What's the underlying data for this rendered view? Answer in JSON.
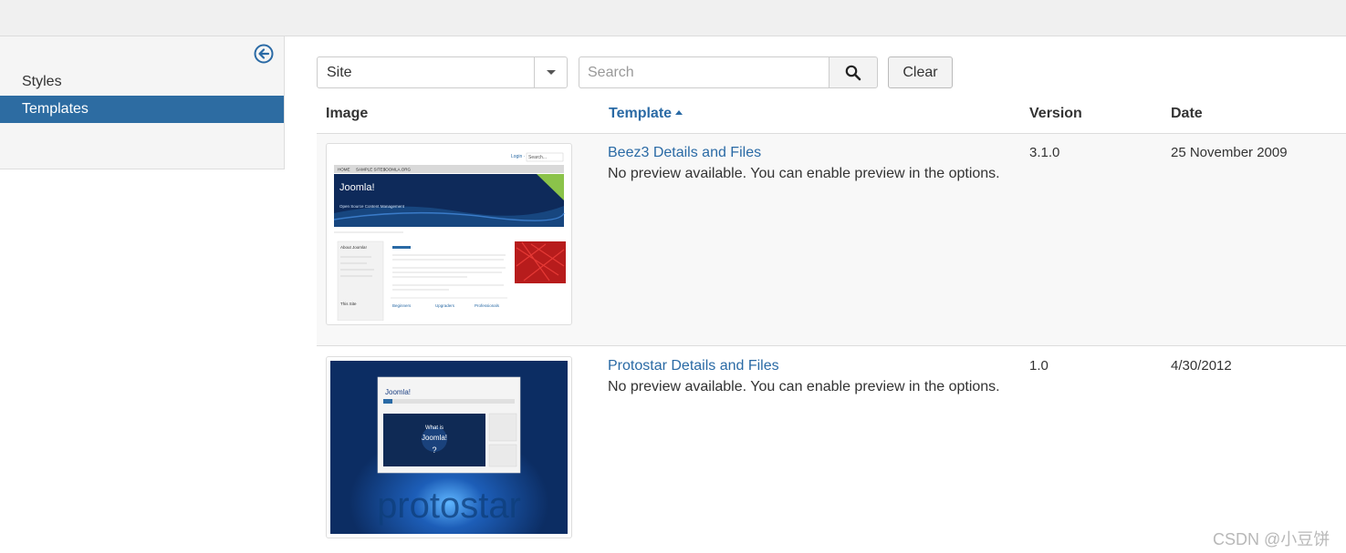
{
  "sidebar": {
    "items": [
      {
        "label": "Styles",
        "active": false
      },
      {
        "label": "Templates",
        "active": true
      }
    ],
    "collapse_icon": "arrow-left-circle-icon"
  },
  "filters": {
    "client_select": {
      "value": "Site"
    },
    "search": {
      "placeholder": "Search",
      "value": ""
    },
    "clear_label": "Clear"
  },
  "table": {
    "columns": {
      "image": "Image",
      "template": "Template",
      "version": "Version",
      "date": "Date"
    },
    "sort": {
      "column": "Template",
      "direction": "asc"
    },
    "rows": [
      {
        "title": "Beez3 Details and Files",
        "note": "No preview available. You can enable preview in the options.",
        "version": "3.1.0",
        "date": "25 November 2009",
        "thumb": {
          "site_name": "Joomla!",
          "tagline": "Open Source Content Management",
          "nav": [
            "HOME",
            "SAMPLE SITES",
            "JOOMLA.ORG"
          ],
          "sidebar_heading": "About Joomla!",
          "sidebar_heading2": "This Site",
          "columns": [
            "Beginners",
            "Upgraders",
            "Professionals"
          ],
          "search_label": "Search..."
        }
      },
      {
        "title": "Protostar Details and Files",
        "note": "No preview available. You can enable preview in the options.",
        "version": "1.0",
        "date": "4/30/2012",
        "thumb": {
          "logo": "Joomla!",
          "video_text_1": "What is",
          "video_text_2": "Joomla!",
          "big_word": "protostar"
        }
      }
    ]
  },
  "watermark": "CSDN @小豆饼",
  "colors": {
    "accent": "#2d6ca2",
    "link": "#2a6aa5"
  }
}
